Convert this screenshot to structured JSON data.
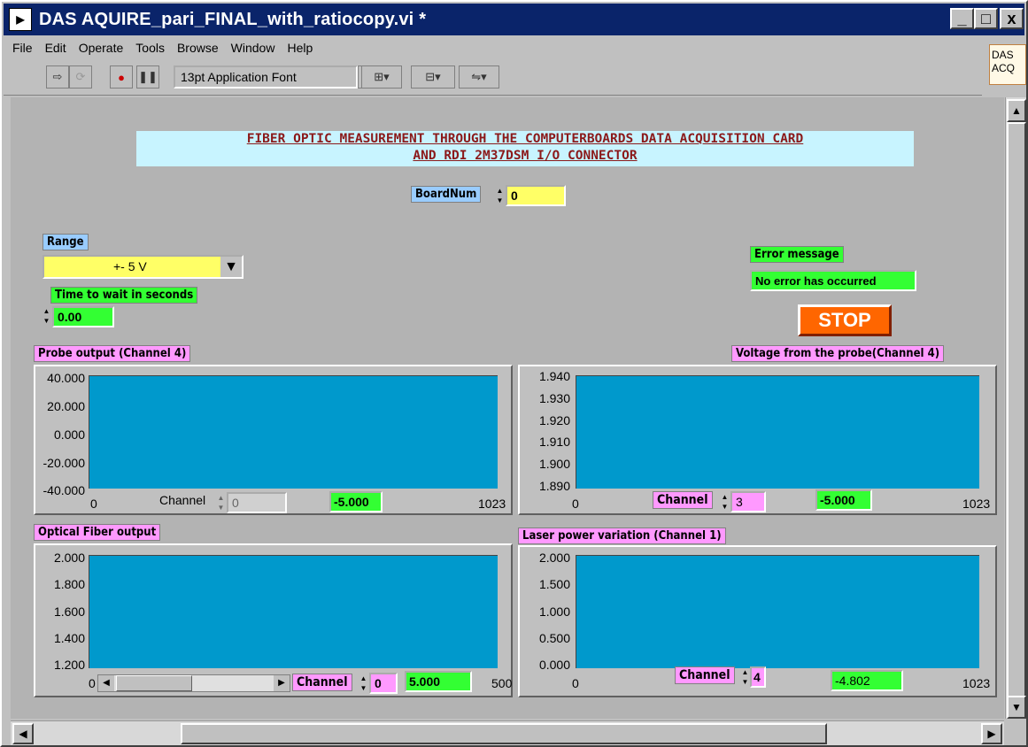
{
  "window": {
    "title": "DAS AQUIRE_pari_FINAL_with_ratiocopy.vi *",
    "min_glyph": "_",
    "max_glyph": "□",
    "close_glyph": "x"
  },
  "menu": [
    "File",
    "Edit",
    "Operate",
    "Tools",
    "Browse",
    "Window",
    "Help"
  ],
  "toolbar": {
    "font_select": "13pt Application Font",
    "icons": [
      "run-arrow-icon",
      "run-continuous-icon",
      "abort-icon",
      "pause-icon",
      "align-icon",
      "distribute-icon",
      "reorder-icon"
    ]
  },
  "vi_icon": {
    "line1": "DAS",
    "line2": "ACQ"
  },
  "heading": {
    "line1": "FIBER OPTIC MEASUREMENT THROUGH THE COMPUTERBOARDS DATA ACQUISITION CARD",
    "line2": "AND RDI 2M37DSM I/O CONNECTOR"
  },
  "board": {
    "label": "BoardNum",
    "value": "0"
  },
  "range": {
    "label": "Range",
    "value": "+- 5 V"
  },
  "wait": {
    "label": "Time to wait in seconds",
    "value": "0.00"
  },
  "error": {
    "label": "Error message",
    "value": "No error has occurred"
  },
  "stop": {
    "label": "STOP"
  },
  "graphs": {
    "probe": {
      "label": "Probe output (Channel 4)",
      "yticks": [
        "40.000",
        "20.000",
        "0.000",
        "-20.000",
        "-40.000"
      ],
      "xmin": "0",
      "xmax": "1023",
      "channel_label": "Channel",
      "channel_value": "0",
      "readout": "-5.000"
    },
    "voltage": {
      "label": "Voltage from the probe(Channel 4)",
      "yticks": [
        "1.940",
        "1.930",
        "1.920",
        "1.910",
        "1.900",
        "1.890"
      ],
      "xmin": "0",
      "xmax": "1023",
      "channel_label": "Channel",
      "channel_value": "3",
      "readout": "-5.000"
    },
    "fiber": {
      "label": "Optical Fiber output",
      "yticks": [
        "2.000",
        "1.800",
        "1.600",
        "1.400",
        "1.200"
      ],
      "xmin": "0",
      "xmax": "500",
      "channel_label": "Channel",
      "channel_value": "0",
      "readout": "5.000"
    },
    "laser": {
      "label": "Laser power variation (Channel 1)",
      "yticks": [
        "2.000",
        "1.500",
        "1.000",
        "0.500",
        "0.000"
      ],
      "xmin": "0",
      "xmax": "1023",
      "channel_label": "Channel",
      "channel_value": "4",
      "readout": "-4.802"
    }
  },
  "colors": {
    "plot_bg": "#0099cc",
    "title_bar": "#0a246a",
    "label_green": "#33ff33",
    "label_pink": "#ff99ff",
    "label_blue": "#99ccff",
    "stop_orange": "#ff6600",
    "yellow_field": "#ffff66"
  }
}
